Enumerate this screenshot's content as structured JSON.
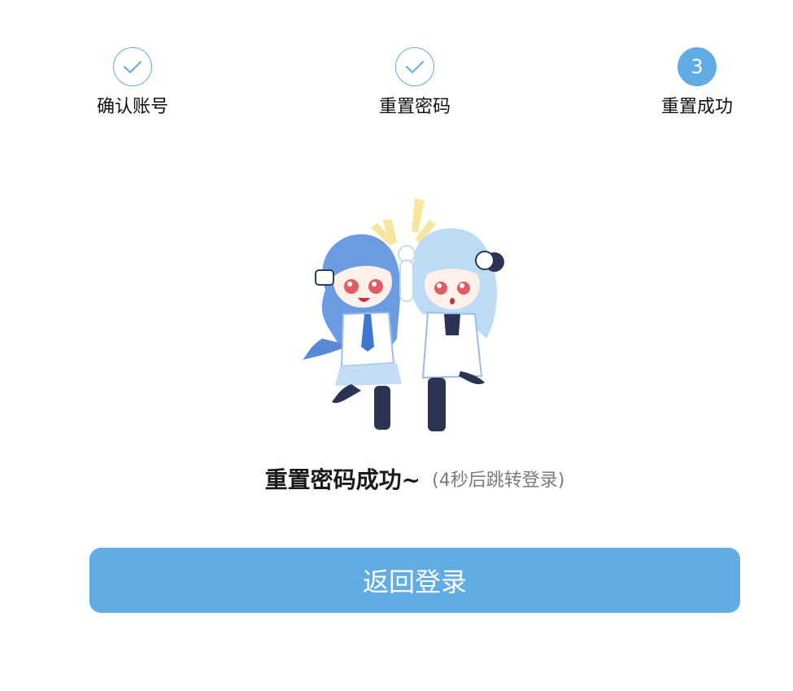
{
  "steps": [
    {
      "label": "确认账号",
      "status": "done"
    },
    {
      "label": "重置密码",
      "status": "done"
    },
    {
      "label": "重置成功",
      "status": "current",
      "number": "3"
    }
  ],
  "result": {
    "title": "重置密码成功~",
    "note": "(4秒后跳转登录)"
  },
  "actions": {
    "back_label": "返回登录"
  },
  "colors": {
    "accent": "#61ace4",
    "text": "#111111",
    "muted": "#7a7a7a",
    "sparkle": "#f7e6a0"
  },
  "icons": {
    "done_step": "checkmark-icon",
    "illustration": "two-anime-mascots-high-five"
  }
}
